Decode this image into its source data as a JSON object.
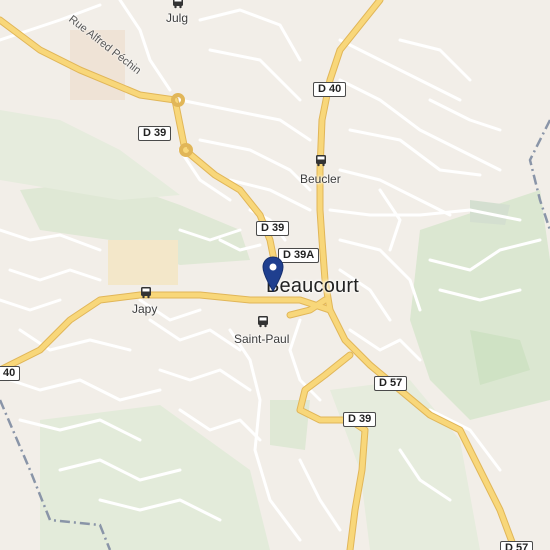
{
  "map": {
    "city": "Beaucourt",
    "places": {
      "julg": "Julg",
      "beucler": "Beucler",
      "japy": "Japy",
      "saint_paul": "Saint-Paul"
    },
    "streets": {
      "rue_alfred_pechin": "Rue Alfred Péchin"
    },
    "road_badges": {
      "d40_top": "D 40",
      "d39_left": "D 39",
      "d39_center": "D 39",
      "d39a": "D 39A",
      "d40_left": "40",
      "d57": "D 57",
      "d39_bottom": "D 39",
      "d57_bottom": "D 57"
    },
    "icons": {
      "bus": "bus-stop-icon",
      "marker": "location-pin-icon"
    },
    "colors": {
      "background": "#f2eee8",
      "major_road": "#f6cf6a",
      "minor_road": "#ffffff",
      "green": "#dde8d2",
      "pin": "#1f3f8f"
    }
  }
}
